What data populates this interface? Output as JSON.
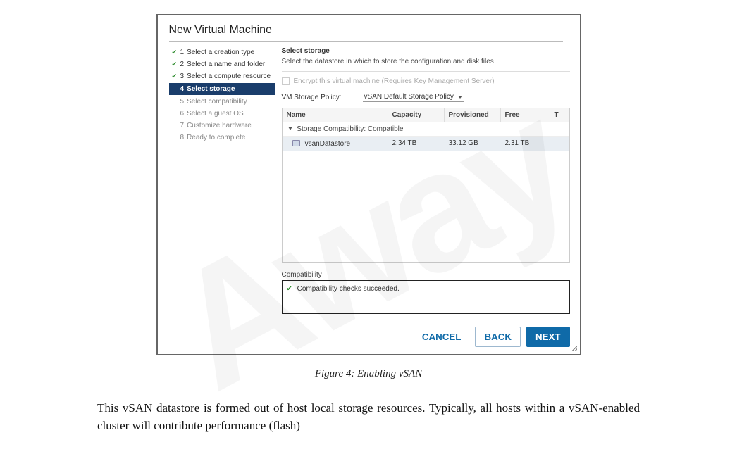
{
  "dialog": {
    "title": "New Virtual Machine",
    "steps": [
      {
        "num": "1",
        "label": "Select a creation type",
        "state": "done"
      },
      {
        "num": "2",
        "label": "Select a name and folder",
        "state": "done"
      },
      {
        "num": "3",
        "label": "Select a compute resource",
        "state": "done"
      },
      {
        "num": "4",
        "label": "Select storage",
        "state": "current"
      },
      {
        "num": "5",
        "label": "Select compatibility",
        "state": "future"
      },
      {
        "num": "6",
        "label": "Select a guest OS",
        "state": "future"
      },
      {
        "num": "7",
        "label": "Customize hardware",
        "state": "future"
      },
      {
        "num": "8",
        "label": "Ready to complete",
        "state": "future"
      }
    ],
    "content_title": "Select storage",
    "content_subtitle": "Select the datastore in which to store the configuration and disk files",
    "encrypt_label": "Encrypt this virtual machine (Requires Key Management Server)",
    "policy_label": "VM Storage Policy:",
    "policy_value": "vSAN Default Storage Policy",
    "table": {
      "headers": {
        "name": "Name",
        "capacity": "Capacity",
        "provisioned": "Provisioned",
        "free": "Free",
        "tail": "T"
      },
      "group": "Storage Compatibility: Compatible",
      "row": {
        "name": "vsanDatastore",
        "capacity": "2.34 TB",
        "provisioned": "33.12 GB",
        "free": "2.31 TB"
      }
    },
    "compat_label": "Compatibility",
    "compat_msg": "Compatibility checks succeeded.",
    "buttons": {
      "cancel": "CANCEL",
      "back": "BACK",
      "next": "NEXT"
    }
  },
  "caption": "Figure 4: Enabling vSAN",
  "paragraph": "This vSAN datastore is formed out of host local storage resources. Typically, all hosts within a vSAN-enabled cluster will contribute performance (flash)",
  "watermark": "Away"
}
